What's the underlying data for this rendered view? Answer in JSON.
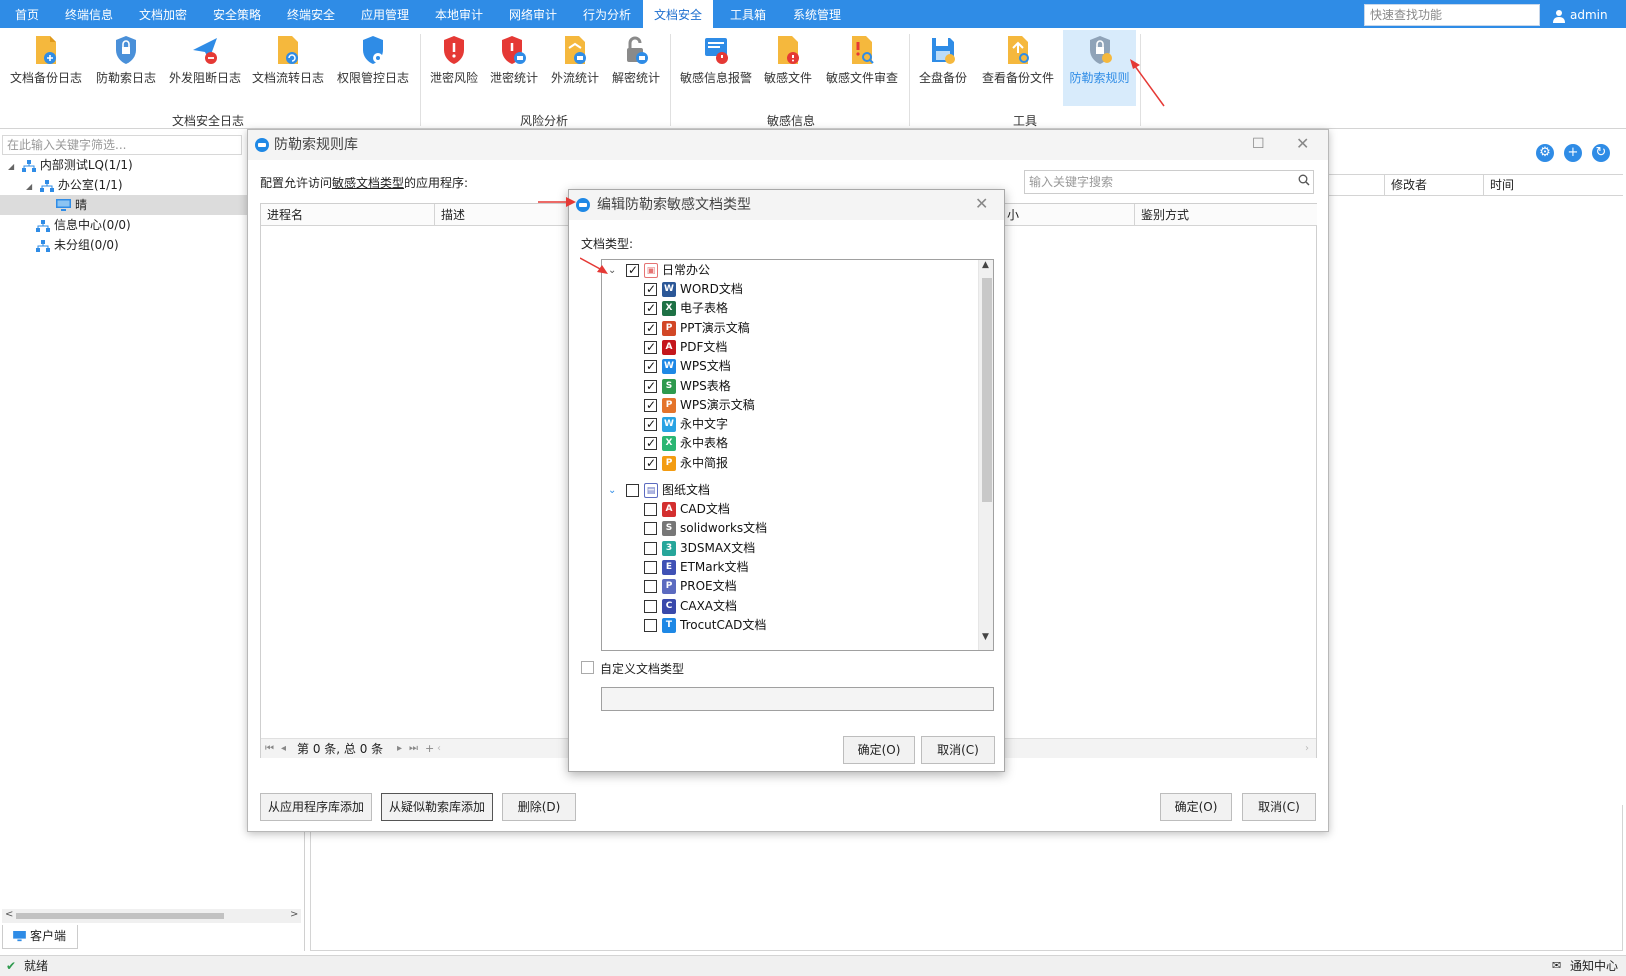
{
  "nav": {
    "items": [
      "首页",
      "终端信息",
      "文档加密",
      "安全策略",
      "终端安全",
      "应用管理",
      "本地审计",
      "网络审计",
      "行为分析",
      "文档安全",
      "工具箱",
      "系统管理"
    ],
    "active_index": 9,
    "quick_search_placeholder": "快速查找功能",
    "user": "admin"
  },
  "ribbon": {
    "buttons": [
      {
        "label": "文档备份日志",
        "icon": "doc-backup-log-icon"
      },
      {
        "label": "防勒索日志",
        "icon": "anti-ransom-log-icon"
      },
      {
        "label": "外发阻断日志",
        "icon": "outbound-block-log-icon"
      },
      {
        "label": "文档流转日志",
        "icon": "doc-flow-log-icon"
      },
      {
        "label": "权限管控日志",
        "icon": "permission-log-icon"
      },
      {
        "label": "泄密风险",
        "icon": "leak-risk-icon"
      },
      {
        "label": "泄密统计",
        "icon": "leak-stats-icon"
      },
      {
        "label": "外流统计",
        "icon": "outflow-stats-icon"
      },
      {
        "label": "解密统计",
        "icon": "decrypt-stats-icon"
      },
      {
        "label": "敏感信息报警",
        "icon": "sensitive-alarm-icon"
      },
      {
        "label": "敏感文件",
        "icon": "sensitive-file-icon"
      },
      {
        "label": "敏感文件审查",
        "icon": "sensitive-review-icon"
      },
      {
        "label": "全盘备份",
        "icon": "full-backup-icon"
      },
      {
        "label": "查看备份文件",
        "icon": "view-backup-icon"
      },
      {
        "label": "防勒索规则",
        "icon": "anti-ransom-rule-icon"
      }
    ],
    "groups": [
      "文档安全日志",
      "风险分析",
      "敏感信息",
      "工具"
    ]
  },
  "left": {
    "filter_placeholder": "在此输入关键字筛选...",
    "tree": [
      "内部测试LQ(1/1)",
      "办公室(1/1)",
      "晴",
      "信息中心(0/0)",
      "未分组(0/0)"
    ],
    "tab": "客户端"
  },
  "right": {
    "columns": [
      "修改者",
      "时间"
    ]
  },
  "status": {
    "text": "就绪",
    "notify": "通知中心"
  },
  "dialog1": {
    "title": "防勒索规则库",
    "desc_prefix": "配置允许访问",
    "desc_link": "敏感文档类型",
    "desc_suffix": "的应用程序:",
    "search_placeholder": "输入关键字搜索",
    "columns": [
      "进程名",
      "描述",
      "小",
      "鉴别方式"
    ],
    "pager": "第 0 条, 总 0 条",
    "btn_add_app": "从应用程序库添加",
    "btn_add_suspect": "从疑似勒索库添加",
    "btn_delete": "删除(D)",
    "btn_ok": "确定(O)",
    "btn_cancel": "取消(C)"
  },
  "dialog2": {
    "title": "编辑防勒索敏感文档类型",
    "label": "文档类型:",
    "group1": "日常办公",
    "group1_items": [
      {
        "label": "WORD文档",
        "icon": "word-icon",
        "color": "#2b5797",
        "glyph": "W"
      },
      {
        "label": "电子表格",
        "icon": "excel-icon",
        "color": "#1e7145",
        "glyph": "X"
      },
      {
        "label": "PPT演示文稿",
        "icon": "ppt-icon",
        "color": "#d24726",
        "glyph": "P"
      },
      {
        "label": "PDF文档",
        "icon": "pdf-icon",
        "color": "#c4161c",
        "glyph": "A"
      },
      {
        "label": "WPS文档",
        "icon": "wps-doc-icon",
        "color": "#1e88e5",
        "glyph": "W"
      },
      {
        "label": "WPS表格",
        "icon": "wps-sheet-icon",
        "color": "#2e9a4e",
        "glyph": "S"
      },
      {
        "label": "WPS演示文稿",
        "icon": "wps-ppt-icon",
        "color": "#e4742b",
        "glyph": "P"
      },
      {
        "label": "永中文字",
        "icon": "yozo-text-icon",
        "color": "#29a3e3",
        "glyph": "W"
      },
      {
        "label": "永中表格",
        "icon": "yozo-sheet-icon",
        "color": "#2bb673",
        "glyph": "X"
      },
      {
        "label": "永中简报",
        "icon": "yozo-slide-icon",
        "color": "#f39c12",
        "glyph": "P"
      }
    ],
    "group2": "图纸文档",
    "group2_items": [
      {
        "label": "CAD文档",
        "icon": "cad-icon",
        "color": "#d32f2f",
        "glyph": "A"
      },
      {
        "label": "solidworks文档",
        "icon": "solidworks-icon",
        "color": "#777777",
        "glyph": "S"
      },
      {
        "label": "3DSMAX文档",
        "icon": "3dsmax-icon",
        "color": "#26a69a",
        "glyph": "3"
      },
      {
        "label": "ETMark文档",
        "icon": "etmark-icon",
        "color": "#3f51b5",
        "glyph": "E"
      },
      {
        "label": "PROE文档",
        "icon": "proe-icon",
        "color": "#5c6bc0",
        "glyph": "P"
      },
      {
        "label": "CAXA文档",
        "icon": "caxa-icon",
        "color": "#3949ab",
        "glyph": "C"
      },
      {
        "label": "TrocutCAD文档",
        "icon": "trocutcad-icon",
        "color": "#1e88e5",
        "glyph": "T"
      }
    ],
    "custom_label": "自定义文档类型",
    "btn_ok": "确定(O)",
    "btn_cancel": "取消(C)"
  }
}
